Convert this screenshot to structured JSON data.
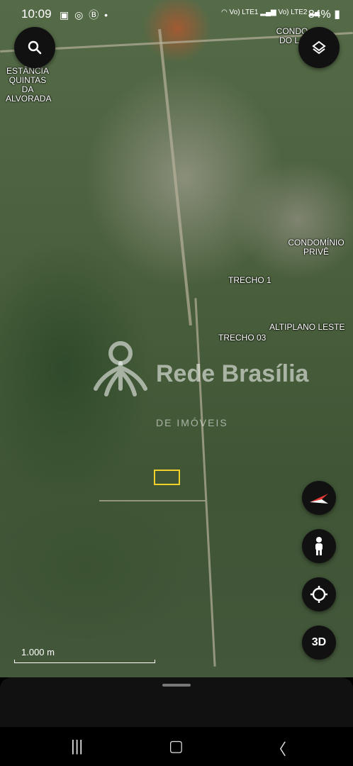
{
  "status_bar": {
    "time": "10:09",
    "battery": "84%",
    "sim1": "Vo) LTE1",
    "sim2": "Vo) LTE2"
  },
  "map": {
    "labels": {
      "estancia": "ESTÂNCIA QUINTAS DA ALVORADA",
      "condo_top": "CONDO DO LA",
      "condominio_prive": "CONDOMÍNIO PRIVÊ",
      "trecho1": "TRECHO 1",
      "trecho03": "TRECHO 03",
      "altiplano": "ALTIPLANO LESTE"
    },
    "watermark": {
      "title": "Rede Brasília",
      "subtitle": "DE IMÓVEIS"
    },
    "scale": "1.000 m"
  },
  "controls": {
    "threed": "3D"
  },
  "icons": {
    "search": "search-icon",
    "layers": "layers-icon",
    "compass": "compass-icon",
    "pegman": "pegman-icon",
    "location": "my-location-icon"
  }
}
